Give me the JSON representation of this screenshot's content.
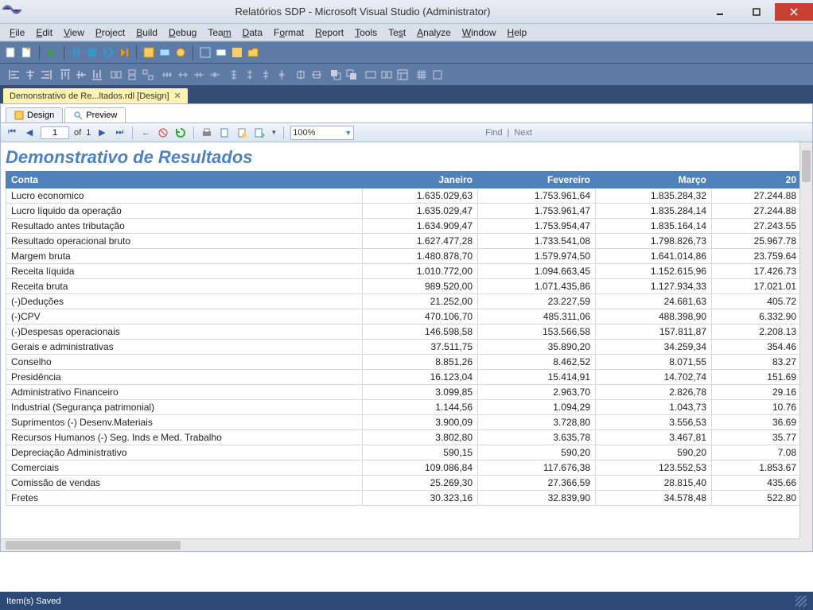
{
  "window": {
    "title": "Relatórios SDP - Microsoft Visual Studio (Administrator)"
  },
  "menu": [
    "File",
    "Edit",
    "View",
    "Project",
    "Build",
    "Debug",
    "Team",
    "Data",
    "Format",
    "Report",
    "Tools",
    "Test",
    "Analyze",
    "Window",
    "Help"
  ],
  "doc_tab": {
    "label": "Demonstrativo de Re...ltados.rdl [Design]"
  },
  "view_tabs": {
    "design": "Design",
    "preview": "Preview"
  },
  "preview_toolbar": {
    "page_current": "1",
    "page_of": "of",
    "page_total": "1",
    "zoom": "100%",
    "find_label": "Find",
    "next_label": "Next"
  },
  "report": {
    "title": "Demonstrativo de Resultados",
    "headers": [
      "Conta",
      "Janeiro",
      "Fevereiro",
      "Março",
      "20"
    ],
    "rows": [
      [
        "Lucro economico",
        "1.635.029,63",
        "1.753.961,64",
        "1.835.284,32",
        "27.244.88"
      ],
      [
        "Lucro líquido da operação",
        "1.635.029,47",
        "1.753.961,47",
        "1.835.284,14",
        "27.244.88"
      ],
      [
        "Resultado antes tributação",
        "1.634.909,47",
        "1.753.954,47",
        "1.835.164,14",
        "27.243.55"
      ],
      [
        "Resultado operacional bruto",
        "1.627.477,28",
        "1.733.541,08",
        "1.798.826,73",
        "25.967.78"
      ],
      [
        "Margem bruta",
        "1.480.878,70",
        "1.579.974,50",
        "1.641.014,86",
        "23.759.64"
      ],
      [
        "Receita líquida",
        "1.010.772,00",
        "1.094.663,45",
        "1.152.615,96",
        "17.426.73"
      ],
      [
        "Receita bruta",
        "989.520,00",
        "1.071.435,86",
        "1.127.934,33",
        "17.021.01"
      ],
      [
        "(-)Deduções",
        "21.252,00",
        "23.227,59",
        "24.681,63",
        "405.72"
      ],
      [
        "(-)CPV",
        "470.106,70",
        "485.311,06",
        "488.398,90",
        "6.332.90"
      ],
      [
        "(-)Despesas operacionais",
        "146.598,58",
        "153.566,58",
        "157.811,87",
        "2.208.13"
      ],
      [
        "Gerais e administrativas",
        "37.511,75",
        "35.890,20",
        "34.259,34",
        "354.46"
      ],
      [
        "Conselho",
        "8.851,26",
        "8.462,52",
        "8.071,55",
        "83.27"
      ],
      [
        "Presidência",
        "16.123,04",
        "15.414,91",
        "14.702,74",
        "151.69"
      ],
      [
        "Administrativo Financeiro",
        "3.099,85",
        "2.963,70",
        "2.826,78",
        "29.16"
      ],
      [
        "Industrial (Segurança patrimonial)",
        "1.144,56",
        "1.094,29",
        "1.043,73",
        "10.76"
      ],
      [
        "Suprimentos (-) Desenv.Materiais",
        "3.900,09",
        "3.728,80",
        "3.556,53",
        "36.69"
      ],
      [
        "Recursos Humanos (-) Seg. Inds e Med. Trabalho",
        "3.802,80",
        "3.635,78",
        "3.467,81",
        "35.77"
      ],
      [
        "Depreciação Administrativo",
        "590,15",
        "590,20",
        "590,20",
        "7.08"
      ],
      [
        "Comerciais",
        "109.086,84",
        "117.676,38",
        "123.552,53",
        "1.853.67"
      ],
      [
        "Comissão de vendas",
        "25.269,30",
        "27.366,59",
        "28.815,40",
        "435.66"
      ],
      [
        "Fretes",
        "30.323,16",
        "32.839,90",
        "34.578,48",
        "522.80"
      ]
    ]
  },
  "status": {
    "text": "Item(s) Saved"
  }
}
